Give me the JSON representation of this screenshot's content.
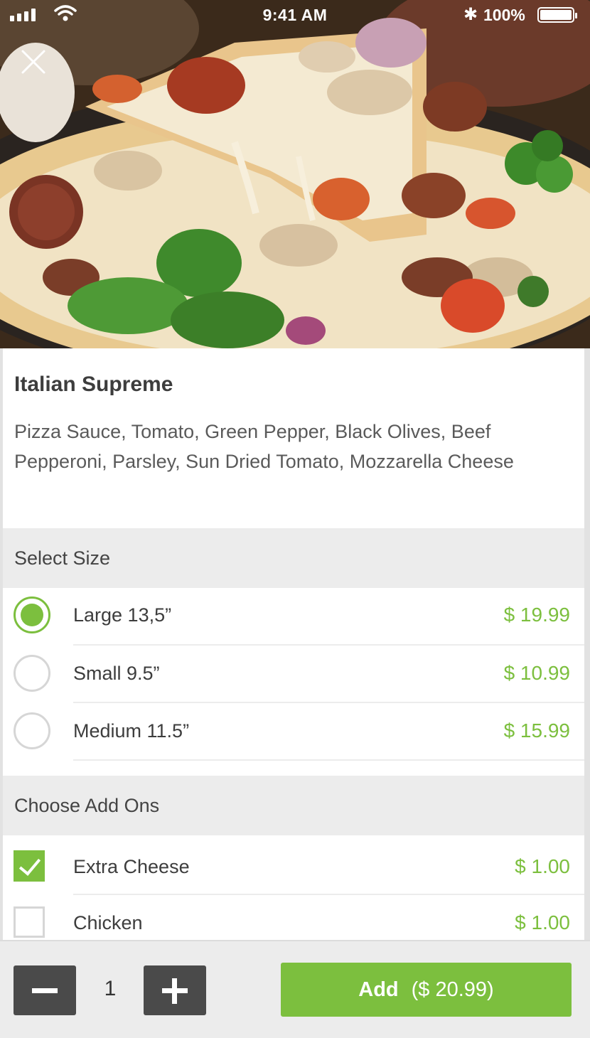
{
  "status_bar": {
    "time": "9:41 AM",
    "battery_percent": "100%",
    "icons": [
      "signal-icon",
      "wifi-icon",
      "bluetooth-icon",
      "battery-icon"
    ]
  },
  "header": {
    "close_icon": "close-icon",
    "image": "pizza-photo"
  },
  "product": {
    "name": "Italian Supreme",
    "description": "Pizza Sauce, Tomato, Green Pepper, Black Olives, Beef Pepperoni, Parsley, Sun Dried Tomato, Mozzarella Cheese"
  },
  "size_section": {
    "title": "Select Size",
    "options": [
      {
        "label": "Large 13,5”",
        "price": "$ 19.99",
        "selected": true
      },
      {
        "label": "Small 9.5”",
        "price": "$ 10.99",
        "selected": false
      },
      {
        "label": "Medium 11.5”",
        "price": "$ 15.99",
        "selected": false
      }
    ]
  },
  "addons_section": {
    "title": "Choose Add Ons",
    "options": [
      {
        "label": "Extra Cheese",
        "price": "$ 1.00",
        "checked": true
      },
      {
        "label": "Chicken",
        "price": "$ 1.00",
        "checked": false
      }
    ]
  },
  "cart": {
    "quantity": "1",
    "add_label": "Add",
    "add_price": "($ 20.99)"
  },
  "colors": {
    "accent": "#7cbf3e",
    "dark_button": "#4a4a4a",
    "section_bg": "#ececec"
  }
}
